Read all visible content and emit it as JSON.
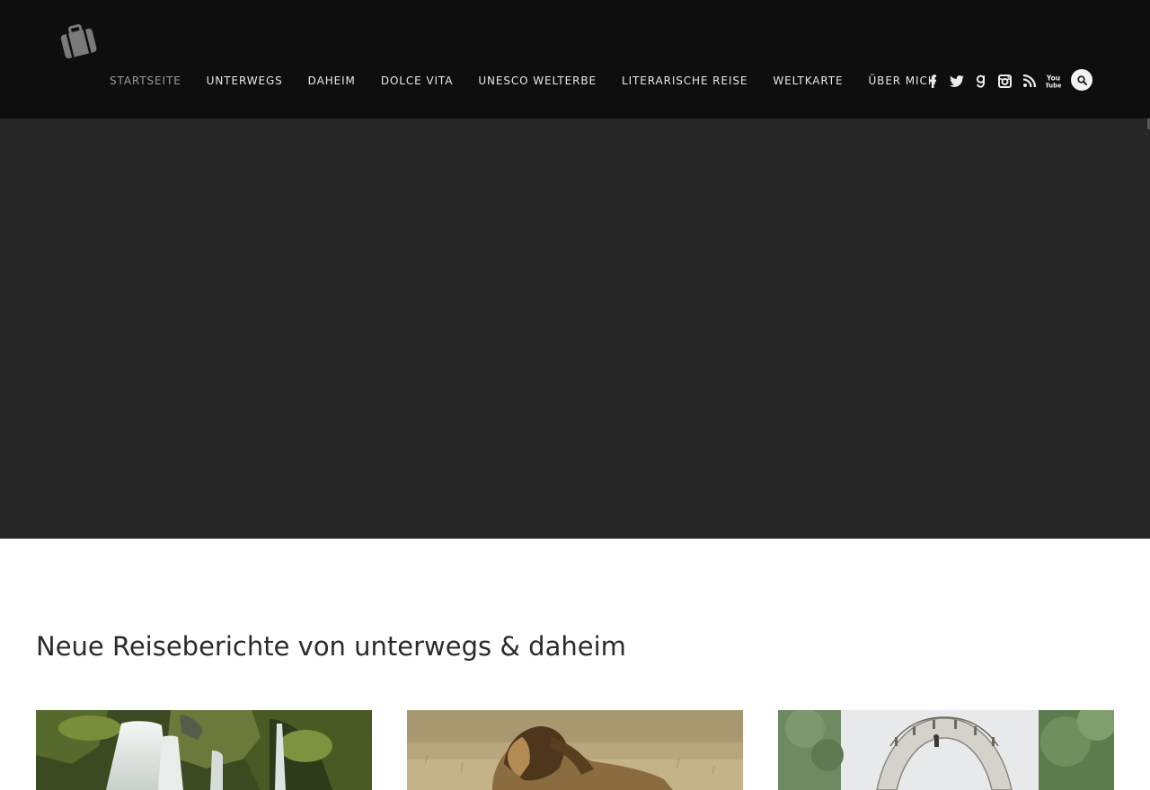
{
  "nav": {
    "items": [
      {
        "label": "STARTSEITE",
        "active": true
      },
      {
        "label": "UNTERWEGS",
        "active": false
      },
      {
        "label": "DAHEIM",
        "active": false
      },
      {
        "label": "DOLCE VITA",
        "active": false
      },
      {
        "label": "UNESCO WELTERBE",
        "active": false
      },
      {
        "label": "LITERARISCHE REISE",
        "active": false
      },
      {
        "label": "WELTKARTE",
        "active": false
      },
      {
        "label": "ÜBER MICH",
        "active": false
      }
    ]
  },
  "social": {
    "icons": [
      "facebook-icon",
      "twitter-icon",
      "goodreads-icon",
      "instagram-icon",
      "rss-icon",
      "youtube-icon"
    ],
    "youtube_text": "You Tube"
  },
  "search": {
    "icon": "search-icon"
  },
  "colors": {
    "header_bg": "#0e0e0e",
    "hero_bg": "#262626",
    "nav_text": "#e9e9e9",
    "nav_active": "#9c9c9c",
    "logo": "#7a7a7a"
  },
  "section": {
    "title": "Neue Reiseberichte von unterwegs & daheim"
  },
  "posts": [
    {
      "image": "waterfall-photo"
    },
    {
      "image": "lion-photo"
    },
    {
      "image": "bridge-photo"
    }
  ]
}
